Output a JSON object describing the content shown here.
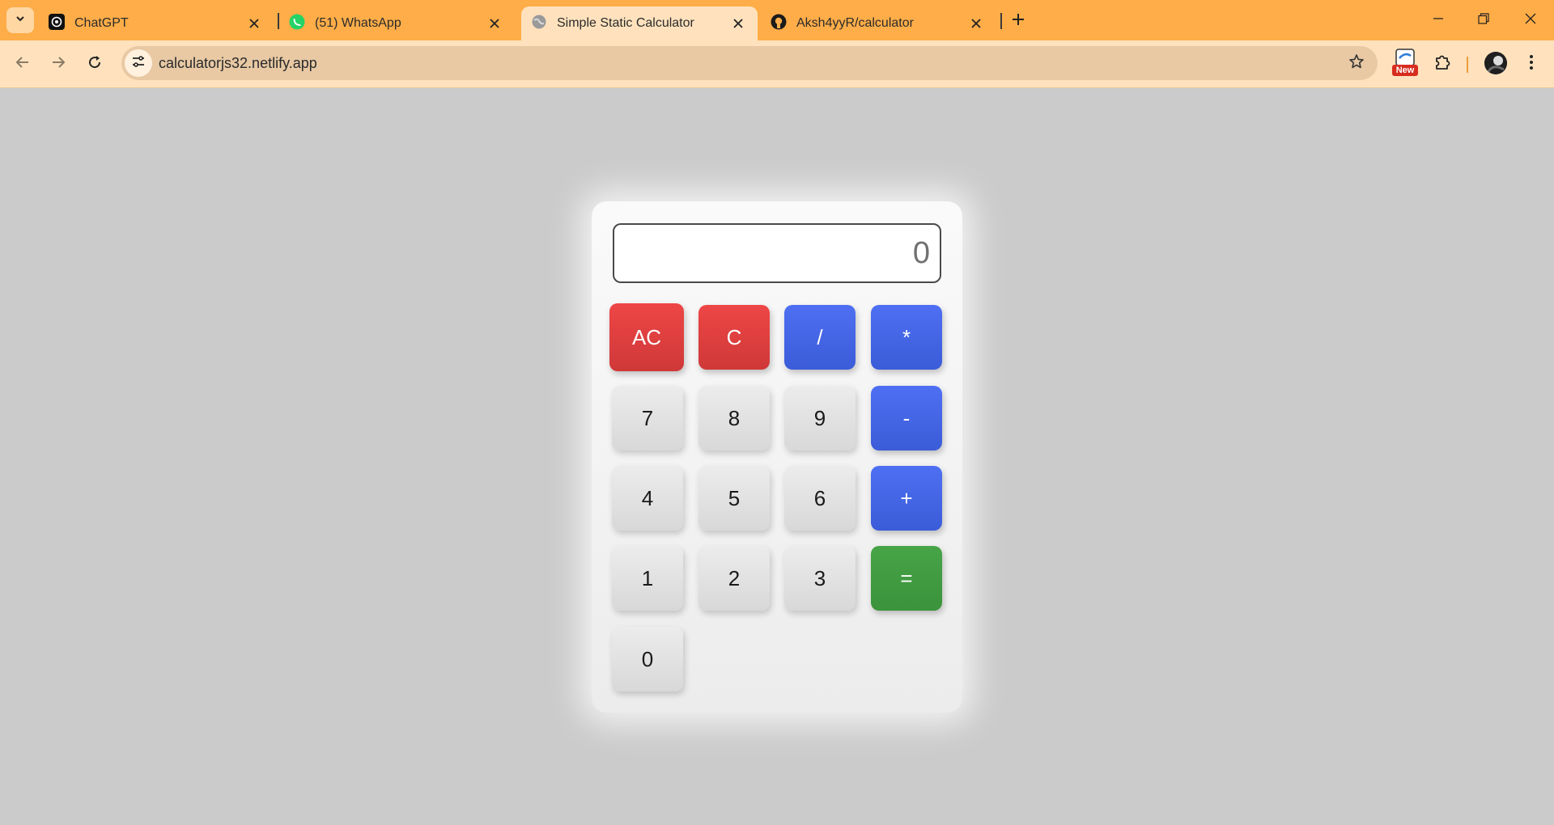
{
  "browser": {
    "tabs": [
      {
        "title": "ChatGPT",
        "icon": "chatgpt-icon",
        "active": false
      },
      {
        "title": "(51) WhatsApp",
        "icon": "whatsapp-icon",
        "active": false
      },
      {
        "title": "Simple Static Calculator",
        "icon": "globe-icon",
        "active": true
      },
      {
        "title": "Aksh4yyR/calculator",
        "icon": "github-icon",
        "active": false
      }
    ],
    "url": "calculatorjs32.netlify.app",
    "extension_badge": "New",
    "colors": {
      "frame": "#ffad48",
      "toolbar": "#ffe2bd",
      "omnibox": "#e8c9a4"
    }
  },
  "calculator": {
    "display_value": "0",
    "keys": {
      "ac": "AC",
      "c": "C",
      "divide": "/",
      "multiply": "*",
      "seven": "7",
      "eight": "8",
      "nine": "9",
      "minus": "-",
      "four": "4",
      "five": "5",
      "six": "6",
      "plus": "+",
      "one": "1",
      "two": "2",
      "three": "3",
      "equals": "=",
      "zero": "0"
    },
    "colors": {
      "clear": "#e04040",
      "operator": "#4566e6",
      "equals": "#419c41",
      "digit": "#e2e2e2",
      "page_bg": "#cbcbcb"
    }
  }
}
